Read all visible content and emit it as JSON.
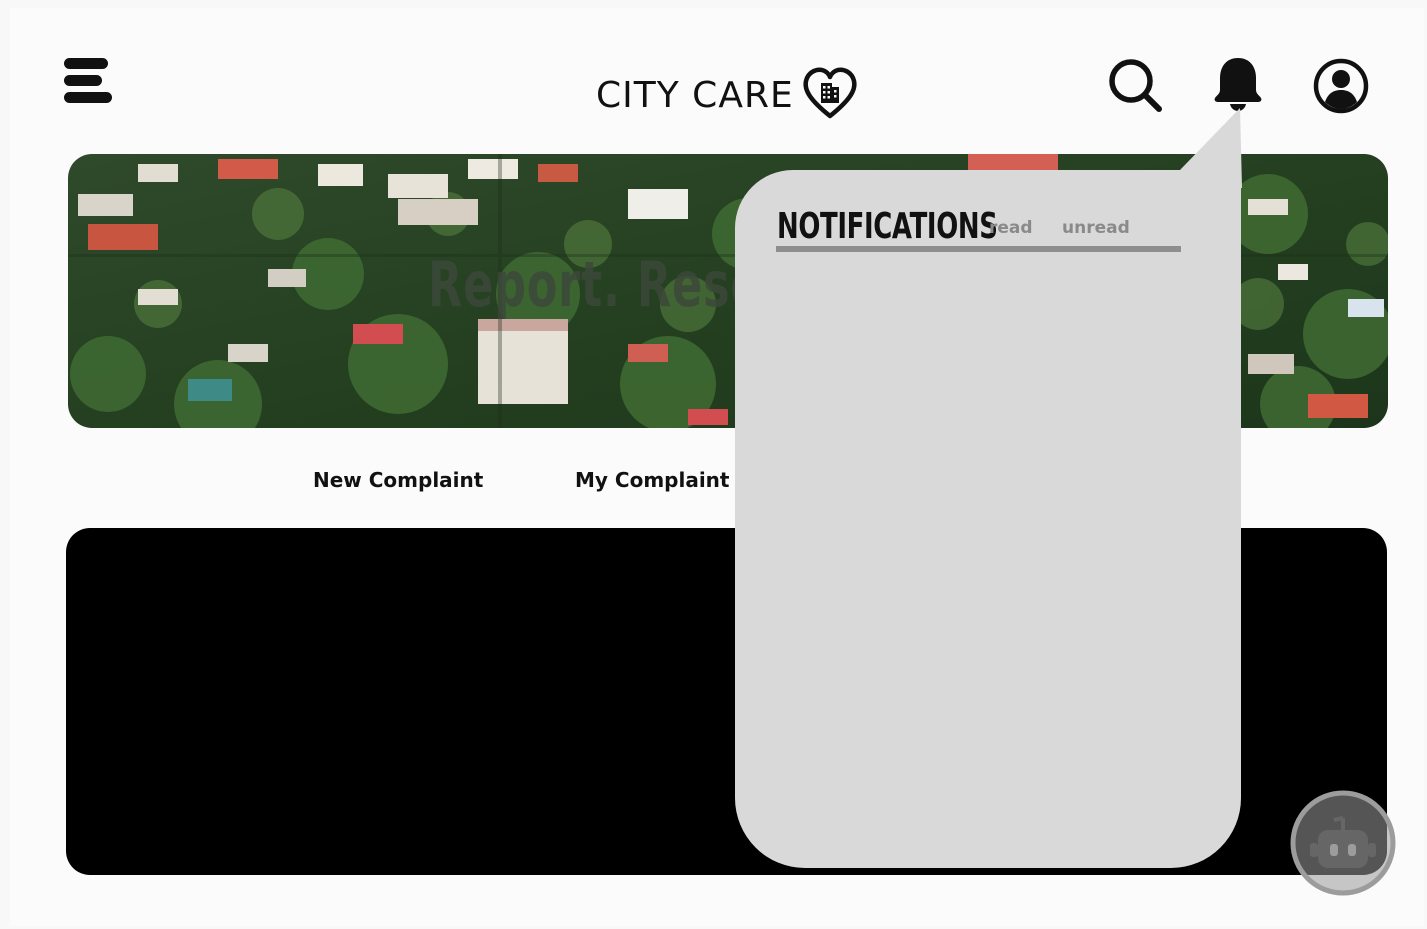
{
  "header": {
    "brand_name": "CITY CARE",
    "menu_icon": "hamburger-menu-icon",
    "brand_icon": "heart-building-icon",
    "search_icon": "search-icon",
    "notifications_icon": "bell-icon",
    "profile_icon": "user-avatar-icon"
  },
  "banner": {
    "tagline": "Report. Reso"
  },
  "tabs": [
    {
      "label": "New Complaint"
    },
    {
      "label": "My Complaint"
    }
  ],
  "notifications": {
    "title": "NOTIFICATIONS",
    "filters": [
      {
        "label": "read"
      },
      {
        "label": "unread"
      }
    ],
    "items": []
  },
  "chatbot": {
    "icon": "robot-icon"
  },
  "colors": {
    "page_background": "#fbfbfc",
    "popover_background": "#d9d9d9",
    "divider": "#8e8e8e",
    "content_panel": "#000000",
    "muted_text": "#8a8a8a"
  }
}
